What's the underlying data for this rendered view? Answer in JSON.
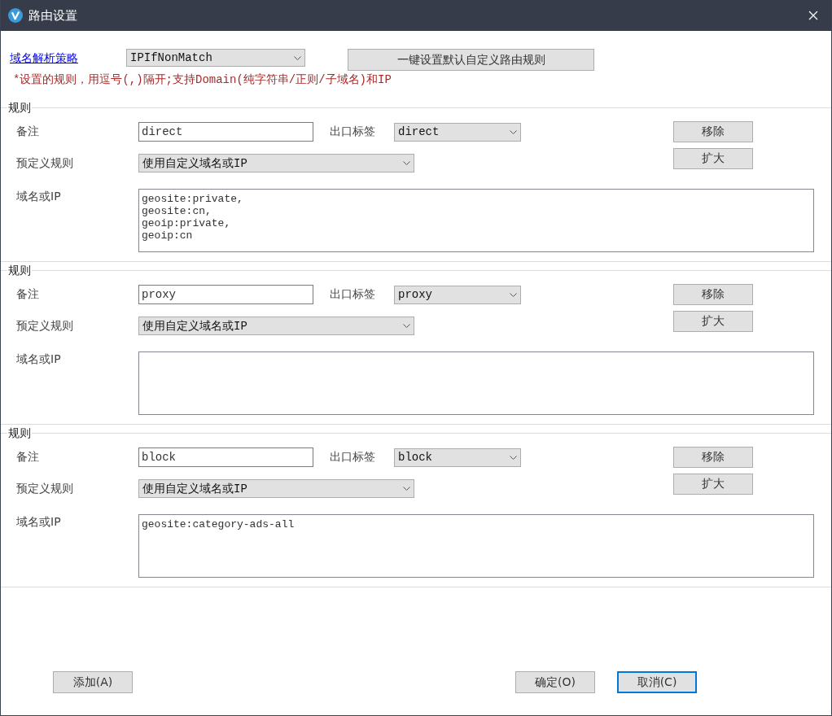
{
  "window": {
    "title": "路由设置"
  },
  "domain_strategy": {
    "label": "域名解析策略",
    "value": "IPIfNonMatch"
  },
  "default_rules_button": "一键设置默认自定义路由规则",
  "hint": "*设置的规则，用逗号(,)隔开;支持Domain(纯字符串/正则/子域名)和IP",
  "rules": [
    {
      "group_title": "规则",
      "remarks_label": "备注",
      "remarks": "direct",
      "outbound_label": "出口标签",
      "outbound": "direct",
      "remove_button": "移除",
      "expand_button": "扩大",
      "predefined_label": "预定义规则",
      "predefined": "使用自定义域名或IP",
      "domain_label": "域名或IP",
      "domain_ip": "geosite:private,\ngeosite:cn,\ngeoip:private,\ngeoip:cn"
    },
    {
      "group_title": "规则",
      "remarks_label": "备注",
      "remarks": "proxy",
      "outbound_label": "出口标签",
      "outbound": "proxy",
      "remove_button": "移除",
      "expand_button": "扩大",
      "predefined_label": "预定义规则",
      "predefined": "使用自定义域名或IP",
      "domain_label": "域名或IP"
    },
    {
      "group_title": "规则",
      "remarks_label": "备注",
      "remarks": "block",
      "outbound_label": "出口标签",
      "outbound": "block",
      "remove_button": "移除",
      "expand_button": "扩大",
      "predefined_label": "预定义规则",
      "predefined": "使用自定义域名或IP",
      "domain_label": "域名或IP",
      "domain_ip": "geosite:category-ads-all"
    }
  ],
  "buttons": [
    {
      "label": "添加(A)",
      "focused": false
    },
    {
      "label": "确定(O)",
      "focused": false
    },
    {
      "label": "取消(C)",
      "focused": true
    }
  ]
}
